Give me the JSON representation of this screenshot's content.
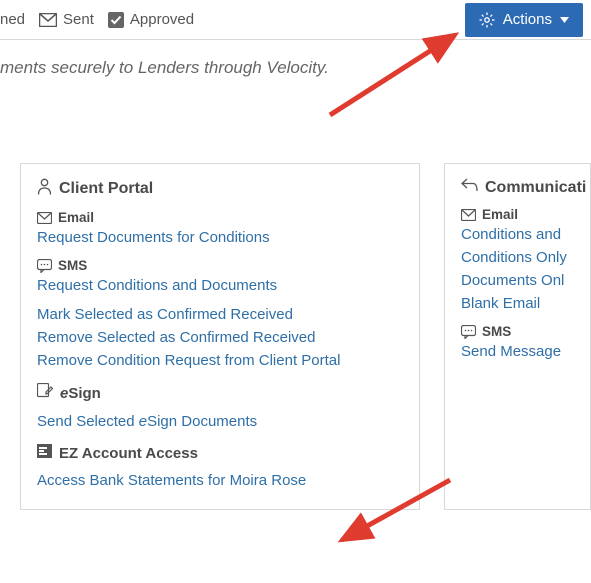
{
  "topbar": {
    "status1": "ned",
    "status2": "Sent",
    "status3": "Approved",
    "actions_label": "Actions"
  },
  "tagline": "ments securely to Lenders through Velocity.",
  "portal": {
    "title": "Client Portal",
    "email_label": "Email",
    "email_link": "Request Documents for Conditions",
    "sms_label": "SMS",
    "sms_link": "Request Conditions and Documents",
    "link_mark": "Mark Selected as Confirmed Received",
    "link_remove": "Remove Selected as Confirmed Received",
    "link_remove_portal": "Remove Condition Request from Client Portal",
    "esign_prefix": "e",
    "esign_title": "Sign",
    "esign_link_pre": "Send Selected ",
    "esign_link_mid": "e",
    "esign_link_post": "Sign Documents",
    "ez_title": "EZ Account Access",
    "ez_link": "Access Bank Statements for Moira Rose"
  },
  "comm": {
    "title": "Communicati",
    "email_label": "Email",
    "link1": "Conditions and",
    "link2": "Conditions Only",
    "link3": "Documents Onl",
    "link4": "Blank Email",
    "sms_label": "SMS",
    "sms_link": "Send Message"
  }
}
